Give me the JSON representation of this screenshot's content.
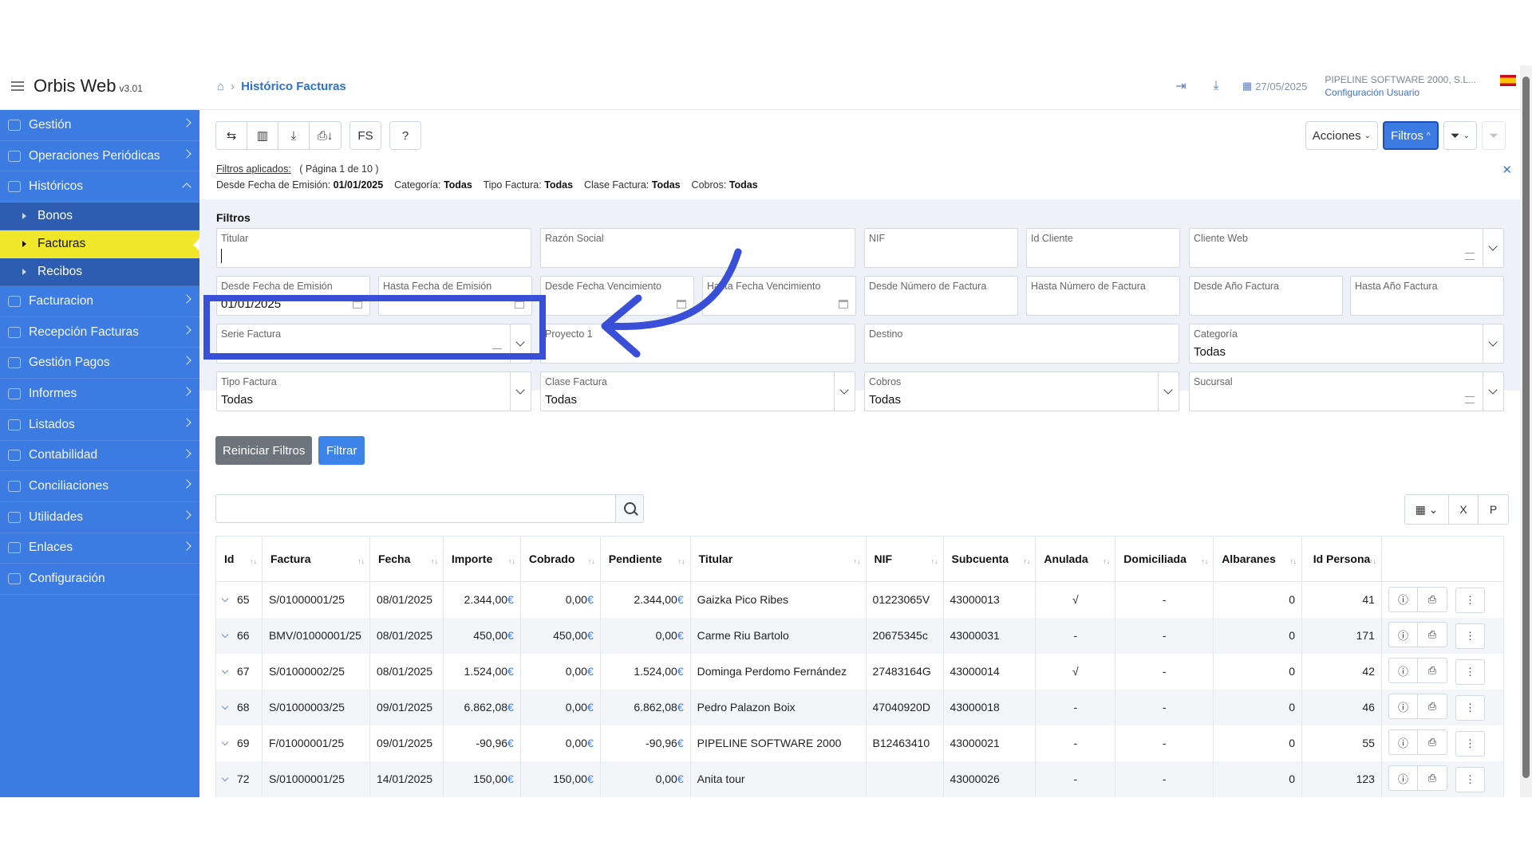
{
  "app": {
    "name": "Orbis Web",
    "version": "v3.01"
  },
  "breadcrumb": {
    "current": "Histórico Facturas"
  },
  "header": {
    "date": "27/05/2025",
    "company": "PIPELINE SOFTWARE 2000, S.L...",
    "user_config": "Configuración Usuario"
  },
  "sidebar": {
    "items": [
      {
        "label": "Gestión"
      },
      {
        "label": "Operaciones Periódicas"
      },
      {
        "label": "Históricos"
      },
      {
        "label": "Facturacion"
      },
      {
        "label": "Recepción Facturas"
      },
      {
        "label": "Gestión Pagos"
      },
      {
        "label": "Informes"
      },
      {
        "label": "Listados"
      },
      {
        "label": "Contabilidad"
      },
      {
        "label": "Conciliaciones"
      },
      {
        "label": "Utilidades"
      },
      {
        "label": "Enlaces"
      },
      {
        "label": "Configuración"
      }
    ],
    "sub": [
      {
        "label": "Bonos"
      },
      {
        "label": "Facturas"
      },
      {
        "label": "Recibos"
      }
    ]
  },
  "toolbar": {
    "acciones": "Acciones",
    "filtros": "Filtros"
  },
  "applied": {
    "label": "Filtros aplicados:",
    "page": "( Página 1 de 10 )",
    "f1_k": "Desde Fecha de Emisión:",
    "f1_v": "01/01/2025",
    "f2_k": "Categoría:",
    "f2_v": "Todas",
    "f3_k": "Tipo Factura:",
    "f3_v": "Todas",
    "f4_k": "Clase Factura:",
    "f4_v": "Todas",
    "f5_k": "Cobros:",
    "f5_v": "Todas"
  },
  "filters": {
    "title": "Filtros",
    "titular": "Titular",
    "razon_social": "Razón Social",
    "nif": "NIF",
    "id_cliente": "Id Cliente",
    "cliente_web": "Cliente Web",
    "desde_fecha_emision": "Desde Fecha de Emisión",
    "desde_fecha_emision_val": "01/01/2025",
    "hasta_fecha_emision": "Hasta Fecha de Emisión",
    "desde_fecha_venc": "Desde Fecha Vencimiento",
    "hasta_fecha_venc": "Hasta Fecha Vencimiento",
    "desde_num_factura": "Desde Número de Factura",
    "hasta_num_factura": "Hasta Número de Factura",
    "desde_anio": "Desde Año Factura",
    "hasta_anio": "Hasta Año Factura",
    "serie_factura": "Serie Factura",
    "proyecto": "Proyecto 1",
    "destino": "Destino",
    "categoria": "Categoría",
    "categoria_val": "Todas",
    "tipo_factura": "Tipo Factura",
    "tipo_factura_val": "Todas",
    "clase_factura": "Clase Factura",
    "clase_factura_val": "Todas",
    "cobros": "Cobros",
    "cobros_val": "Todas",
    "sucursal": "Sucursal",
    "reset": "Reiniciar Filtros",
    "apply": "Filtrar"
  },
  "table": {
    "headers": [
      "Id",
      "Factura",
      "Fecha",
      "Importe",
      "Cobrado",
      "Pendiente",
      "Titular",
      "NIF",
      "Subcuenta",
      "Anulada",
      "Domiciliada",
      "Albaranes",
      "Id Persona"
    ],
    "currency": "€",
    "rows": [
      {
        "id": "65",
        "factura": "S/01000001/25",
        "fecha": "08/01/2025",
        "importe": "2.344,00",
        "cobrado": "0,00",
        "pendiente": "2.344,00",
        "titular": "Gaizka Pico Ribes",
        "nif": "01223065V",
        "subcuenta": "43000013",
        "anulada": "√",
        "domiciliada": "-",
        "albaranes": "0",
        "persona": "41"
      },
      {
        "id": "66",
        "factura": "BMV/01000001/25",
        "fecha": "08/01/2025",
        "importe": "450,00",
        "cobrado": "450,00",
        "pendiente": "0,00",
        "titular": "Carme Riu Bartolo",
        "nif": "20675345c",
        "subcuenta": "43000031",
        "anulada": "-",
        "domiciliada": "-",
        "albaranes": "0",
        "persona": "171"
      },
      {
        "id": "67",
        "factura": "S/01000002/25",
        "fecha": "08/01/2025",
        "importe": "1.524,00",
        "cobrado": "0,00",
        "pendiente": "1.524,00",
        "titular": "Dominga Perdomo Fernández",
        "nif": "27483164G",
        "subcuenta": "43000014",
        "anulada": "√",
        "domiciliada": "-",
        "albaranes": "0",
        "persona": "42"
      },
      {
        "id": "68",
        "factura": "S/01000003/25",
        "fecha": "09/01/2025",
        "importe": "6.862,08",
        "cobrado": "0,00",
        "pendiente": "6.862,08",
        "titular": "Pedro Palazon Boix",
        "nif": "47040920D",
        "subcuenta": "43000018",
        "anulada": "-",
        "domiciliada": "-",
        "albaranes": "0",
        "persona": "46"
      },
      {
        "id": "69",
        "factura": "F/01000001/25",
        "fecha": "09/01/2025",
        "importe": "-90,96",
        "cobrado": "0,00",
        "pendiente": "-90,96",
        "titular": "PIPELINE SOFTWARE 2000",
        "nif": "B12463410",
        "subcuenta": "43000021",
        "anulada": "-",
        "domiciliada": "-",
        "albaranes": "0",
        "persona": "55"
      },
      {
        "id": "72",
        "factura": "S/01000001/25",
        "fecha": "14/01/2025",
        "importe": "150,00",
        "cobrado": "150,00",
        "pendiente": "0,00",
        "titular": "Anita tour",
        "nif": "",
        "subcuenta": "43000026",
        "anulada": "-",
        "domiciliada": "-",
        "albaranes": "0",
        "persona": "123"
      }
    ]
  },
  "colors": {
    "accent": "#3c7ce2",
    "active": "#f1e72a",
    "annotation": "#3a4fd8"
  }
}
